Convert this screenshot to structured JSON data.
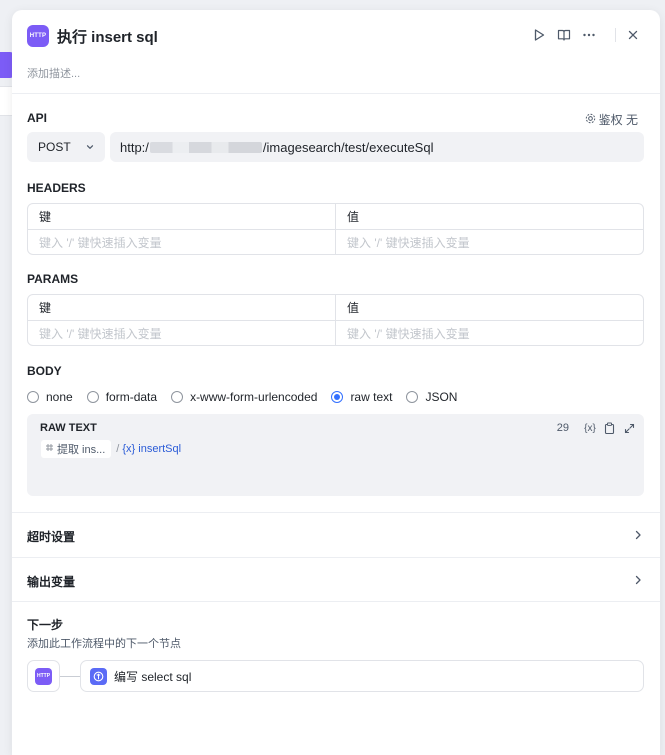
{
  "node": {
    "badge": "HTTP",
    "title": "执行 insert sql",
    "description_placeholder": "添加描述..."
  },
  "api": {
    "label": "API",
    "auth_label": "鉴权 无",
    "method": "POST",
    "url_prefix": "http:/",
    "url_suffix": "/imagesearch/test/executeSql"
  },
  "headers": {
    "label": "HEADERS",
    "key_header": "键",
    "value_header": "值",
    "key_placeholder": "键入 '/' 键快速插入变量",
    "value_placeholder": "键入 '/' 键快速插入变量"
  },
  "params": {
    "label": "PARAMS",
    "key_header": "键",
    "value_header": "值",
    "key_placeholder": "键入 '/' 键快速插入变量",
    "value_placeholder": "键入 '/' 键快速插入变量"
  },
  "body": {
    "label": "BODY",
    "options": [
      "none",
      "form-data",
      "x-www-form-urlencoded",
      "raw text",
      "JSON"
    ],
    "selected": "raw text",
    "raw_label": "RAW TEXT",
    "char_count": "29",
    "var_icon_text": "{x}",
    "tag_source": "提取 ins...",
    "tag_separator": "/",
    "tag_variable": "{x} insertSql"
  },
  "timeout": {
    "label": "超时设置"
  },
  "output": {
    "label": "输出变量"
  },
  "next_step": {
    "title": "下一步",
    "subtitle": "添加此工作流程中的下一个节点",
    "node_badge": "HTTP",
    "next_node_name": "编写 select sql"
  },
  "colors": {
    "accent": "#7c5cf6",
    "radio_selected": "#3370ff",
    "variable_text": "#2a5bd7"
  }
}
